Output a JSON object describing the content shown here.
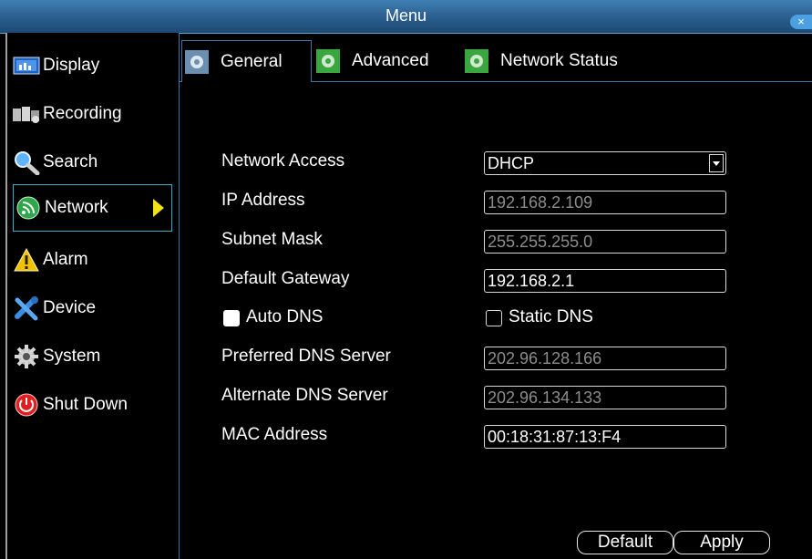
{
  "window": {
    "title": "Menu",
    "close_label": "×"
  },
  "sidebar": {
    "items": [
      {
        "label": "Display",
        "icon": "display-icon"
      },
      {
        "label": "Recording",
        "icon": "recording-icon"
      },
      {
        "label": "Search",
        "icon": "search-icon"
      },
      {
        "label": "Network",
        "icon": "network-icon",
        "active": true
      },
      {
        "label": "Alarm",
        "icon": "alarm-icon"
      },
      {
        "label": "Device",
        "icon": "device-icon"
      },
      {
        "label": "System",
        "icon": "system-icon"
      },
      {
        "label": "Shut Down",
        "icon": "power-icon"
      }
    ]
  },
  "tabs": [
    {
      "label": "General",
      "selected": true
    },
    {
      "label": "Advanced"
    },
    {
      "label": "Network Status"
    }
  ],
  "form": {
    "network_access": {
      "label": "Network Access",
      "value": "DHCP"
    },
    "ip_address": {
      "label": "IP Address",
      "value": "192.168.2.109"
    },
    "subnet_mask": {
      "label": "Subnet Mask",
      "value": "255.255.255.0"
    },
    "default_gateway": {
      "label": "Default Gateway",
      "value": "192.168.2.1"
    },
    "auto_dns": {
      "label": "Auto DNS",
      "checked": true
    },
    "static_dns": {
      "label": "Static DNS",
      "checked": false
    },
    "preferred_dns": {
      "label": "Preferred DNS Server",
      "value": "202.96.128.166"
    },
    "alternate_dns": {
      "label": "Alternate DNS Server",
      "value": "202.96.134.133"
    },
    "mac_address": {
      "label": "MAC Address",
      "value": "00:18:31:87:13:F4"
    }
  },
  "buttons": {
    "default_label": "Default",
    "apply_label": "Apply"
  },
  "colors": {
    "title_bar": "#2a5d8c",
    "accent_border": "#3d76a8",
    "active_arrow": "#f3e217"
  }
}
